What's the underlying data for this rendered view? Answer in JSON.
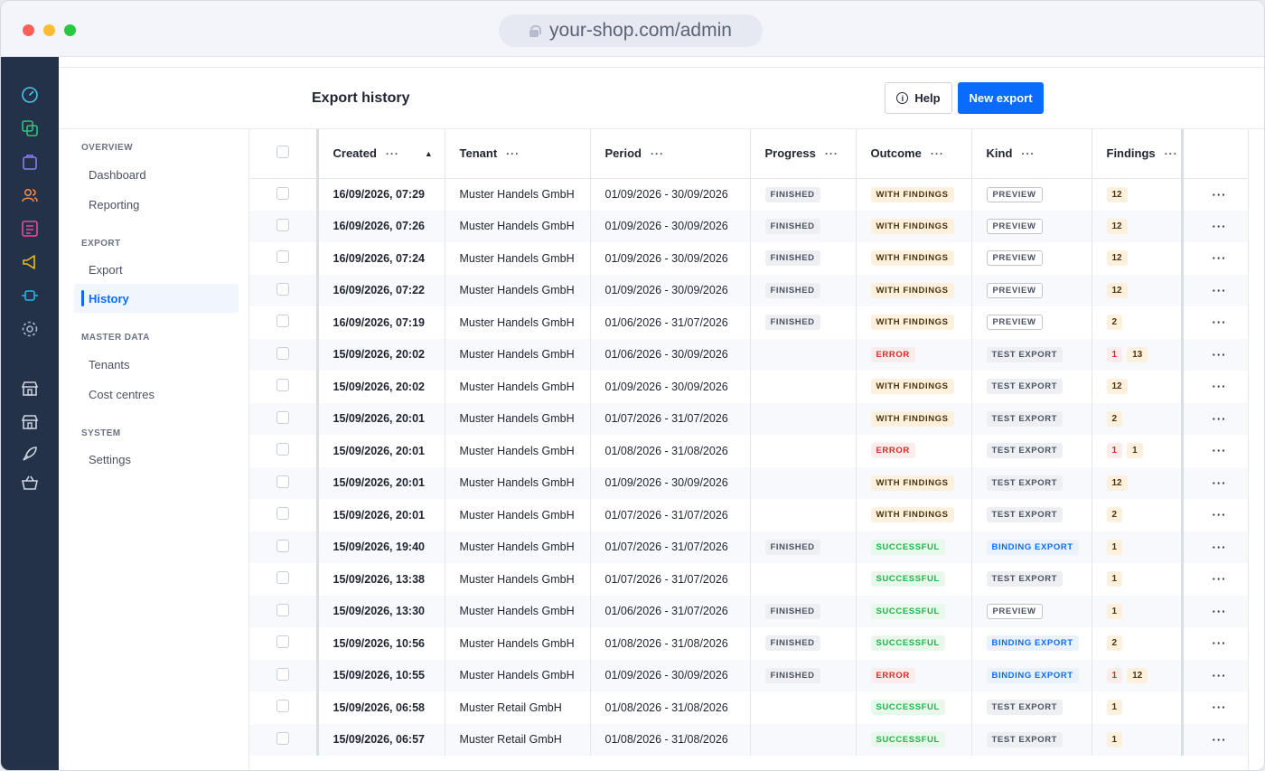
{
  "browser": {
    "url": "your-shop.com/admin"
  },
  "header": {
    "title": "Export history",
    "help_label": "Help",
    "new_export_label": "New export"
  },
  "subnav": {
    "sections": [
      {
        "title": "OVERVIEW",
        "items": [
          "Dashboard",
          "Reporting"
        ]
      },
      {
        "title": "EXPORT",
        "items": [
          "Export",
          "History"
        ]
      },
      {
        "title": "MASTER DATA",
        "items": [
          "Tenants",
          "Cost centres"
        ]
      },
      {
        "title": "SYSTEM",
        "items": [
          "Settings"
        ]
      }
    ],
    "active_item": "History"
  },
  "rail_icons": [
    "dashboard-gauge-icon",
    "copy-icon",
    "bag-icon",
    "users-icon",
    "list-icon",
    "megaphone-icon",
    "plug-icon",
    "gear-icon",
    "store-icon",
    "store-icon",
    "rocket-icon",
    "basket-icon"
  ],
  "table": {
    "columns": [
      "Created",
      "Tenant",
      "Period",
      "Progress",
      "Outcome",
      "Kind",
      "Findings"
    ],
    "sort": {
      "column": "Created",
      "direction": "ascending"
    },
    "rows": [
      {
        "created": "16/09/2026, 07:29",
        "tenant": "Muster Handels GmbH",
        "period": "01/09/2026 - 30/09/2026",
        "progress": "FINISHED",
        "outcome": "WITH FINDINGS",
        "kind": "PREVIEW",
        "findings_error": "",
        "findings_warn": "12"
      },
      {
        "created": "16/09/2026, 07:26",
        "tenant": "Muster Handels GmbH",
        "period": "01/09/2026 - 30/09/2026",
        "progress": "FINISHED",
        "outcome": "WITH FINDINGS",
        "kind": "PREVIEW",
        "findings_error": "",
        "findings_warn": "12"
      },
      {
        "created": "16/09/2026, 07:24",
        "tenant": "Muster Handels GmbH",
        "period": "01/09/2026 - 30/09/2026",
        "progress": "FINISHED",
        "outcome": "WITH FINDINGS",
        "kind": "PREVIEW",
        "findings_error": "",
        "findings_warn": "12"
      },
      {
        "created": "16/09/2026, 07:22",
        "tenant": "Muster Handels GmbH",
        "period": "01/09/2026 - 30/09/2026",
        "progress": "FINISHED",
        "outcome": "WITH FINDINGS",
        "kind": "PREVIEW",
        "findings_error": "",
        "findings_warn": "12"
      },
      {
        "created": "16/09/2026, 07:19",
        "tenant": "Muster Handels GmbH",
        "period": "01/06/2026 - 31/07/2026",
        "progress": "FINISHED",
        "outcome": "WITH FINDINGS",
        "kind": "PREVIEW",
        "findings_error": "",
        "findings_warn": "2"
      },
      {
        "created": "15/09/2026, 20:02",
        "tenant": "Muster Handels GmbH",
        "period": "01/06/2026 - 30/09/2026",
        "progress": "",
        "outcome": "ERROR",
        "kind": "TEST EXPORT",
        "findings_error": "1",
        "findings_warn": "13"
      },
      {
        "created": "15/09/2026, 20:02",
        "tenant": "Muster Handels GmbH",
        "period": "01/09/2026 - 30/09/2026",
        "progress": "",
        "outcome": "WITH FINDINGS",
        "kind": "TEST EXPORT",
        "findings_error": "",
        "findings_warn": "12"
      },
      {
        "created": "15/09/2026, 20:01",
        "tenant": "Muster Handels GmbH",
        "period": "01/07/2026 - 31/07/2026",
        "progress": "",
        "outcome": "WITH FINDINGS",
        "kind": "TEST EXPORT",
        "findings_error": "",
        "findings_warn": "2"
      },
      {
        "created": "15/09/2026, 20:01",
        "tenant": "Muster Handels GmbH",
        "period": "01/08/2026 - 31/08/2026",
        "progress": "",
        "outcome": "ERROR",
        "kind": "TEST EXPORT",
        "findings_error": "1",
        "findings_warn": "1"
      },
      {
        "created": "15/09/2026, 20:01",
        "tenant": "Muster Handels GmbH",
        "period": "01/09/2026 - 30/09/2026",
        "progress": "",
        "outcome": "WITH FINDINGS",
        "kind": "TEST EXPORT",
        "findings_error": "",
        "findings_warn": "12"
      },
      {
        "created": "15/09/2026, 20:01",
        "tenant": "Muster Handels GmbH",
        "period": "01/07/2026 - 31/07/2026",
        "progress": "",
        "outcome": "WITH FINDINGS",
        "kind": "TEST EXPORT",
        "findings_error": "",
        "findings_warn": "2"
      },
      {
        "created": "15/09/2026, 19:40",
        "tenant": "Muster Handels GmbH",
        "period": "01/07/2026 - 31/07/2026",
        "progress": "FINISHED",
        "outcome": "SUCCESSFUL",
        "kind": "BINDING EXPORT",
        "findings_error": "",
        "findings_warn": "1"
      },
      {
        "created": "15/09/2026, 13:38",
        "tenant": "Muster Handels GmbH",
        "period": "01/07/2026 - 31/07/2026",
        "progress": "",
        "outcome": "SUCCESSFUL",
        "kind": "TEST EXPORT",
        "findings_error": "",
        "findings_warn": "1"
      },
      {
        "created": "15/09/2026, 13:30",
        "tenant": "Muster Handels GmbH",
        "period": "01/06/2026 - 31/07/2026",
        "progress": "FINISHED",
        "outcome": "SUCCESSFUL",
        "kind": "PREVIEW",
        "findings_error": "",
        "findings_warn": "1"
      },
      {
        "created": "15/09/2026, 10:56",
        "tenant": "Muster Handels GmbH",
        "period": "01/08/2026 - 31/08/2026",
        "progress": "FINISHED",
        "outcome": "SUCCESSFUL",
        "kind": "BINDING EXPORT",
        "findings_error": "",
        "findings_warn": "2"
      },
      {
        "created": "15/09/2026, 10:55",
        "tenant": "Muster Handels GmbH",
        "period": "01/09/2026 - 30/09/2026",
        "progress": "FINISHED",
        "outcome": "ERROR",
        "kind": "BINDING EXPORT",
        "findings_error": "1",
        "findings_warn": "12"
      },
      {
        "created": "15/09/2026, 06:58",
        "tenant": "Muster Retail GmbH",
        "period": "01/08/2026 - 31/08/2026",
        "progress": "",
        "outcome": "SUCCESSFUL",
        "kind": "TEST EXPORT",
        "findings_error": "",
        "findings_warn": "1"
      },
      {
        "created": "15/09/2026, 06:57",
        "tenant": "Muster Retail GmbH",
        "period": "01/08/2026 - 31/08/2026",
        "progress": "",
        "outcome": "SUCCESSFUL",
        "kind": "TEST EXPORT",
        "findings_error": "",
        "findings_warn": "1"
      }
    ]
  },
  "colors": {
    "accent": "#0a6cff",
    "rail": "#233249"
  }
}
